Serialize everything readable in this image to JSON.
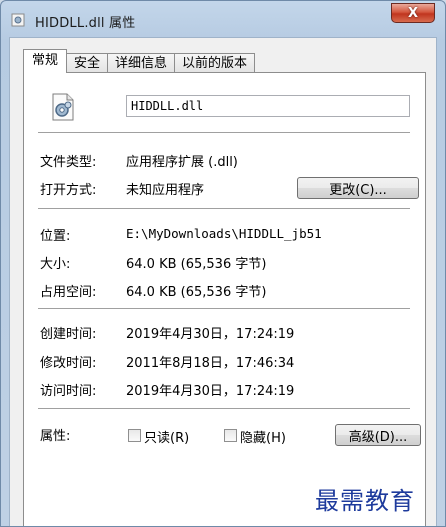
{
  "window": {
    "title": "HIDDLL.dll 属性",
    "close_label": "X"
  },
  "tabs": [
    "常规",
    "安全",
    "详细信息",
    "以前的版本"
  ],
  "general": {
    "filename": "HIDDLL.dll",
    "file_type_label": "文件类型:",
    "file_type_value": "应用程序扩展 (.dll)",
    "opens_with_label": "打开方式:",
    "opens_with_value": "未知应用程序",
    "change_button": "更改(C)...",
    "location_label": "位置:",
    "location_value": "E:\\MyDownloads\\HIDDLL_jb51",
    "size_label": "大小:",
    "size_value": "64.0 KB (65,536 字节)",
    "size_on_disk_label": "占用空间:",
    "size_on_disk_value": "64.0 KB (65,536 字节)",
    "created_label": "创建时间:",
    "created_value": "2019年4月30日，17:24:19",
    "modified_label": "修改时间:",
    "modified_value": "2011年8月18日，17:46:34",
    "accessed_label": "访问时间:",
    "accessed_value": "2019年4月30日，17:24:19",
    "attributes_label": "属性:",
    "readonly_label": "只读(R)",
    "hidden_label": "隐藏(H)",
    "advanced_button": "高级(D)..."
  },
  "watermark": "最需教育",
  "colors": {
    "title_bar": "#bfd1e5",
    "close_button": "#c7432a",
    "watermark": "#1d3a9c"
  }
}
